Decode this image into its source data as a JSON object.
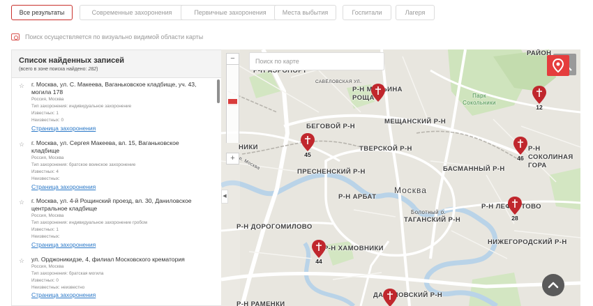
{
  "tabs": [
    {
      "label": "Все результаты",
      "active": true
    },
    {
      "label": "Современные захоронения",
      "active": false
    },
    {
      "label": "Первичные захоронения",
      "active": false
    },
    {
      "label": "Места выбытия",
      "active": false
    },
    {
      "label": "Госпитали",
      "active": false
    },
    {
      "label": "Лагеря",
      "active": false
    }
  ],
  "notice": "Поиск осуществляется по визуально видимой области карты",
  "panel": {
    "title": "Список найденных записей",
    "count_prefix": "(всего в зоне поиска найдено: ",
    "count_value": "282",
    "count_suffix": ")"
  },
  "records": [
    {
      "title": "г. Москва, ул. С. Макеева, Ваганьковское кладбище, уч. 43, могила 178",
      "country": "Россия, Москва",
      "type": "Тип захоронения: индивидуальное захоронение",
      "known": "Известных: 1",
      "unknown": "Неизвестных: 0",
      "link": "Страница захоронения"
    },
    {
      "title": "г. Москва, ул. Сергея Макеева, вл. 15, Ваганьковское кладбище",
      "country": "Россия, Москва",
      "type": "Тип захоронения: братское воинское захоронение",
      "known": "Известных: 4",
      "unknown": "Неизвестных:",
      "link": "Страница захоронения"
    },
    {
      "title": "г. Москва, ул. 4-й Рощинский проезд, вл. 30, Даниловское центральное кладбище",
      "country": "Россия, Москва",
      "type": "Тип захоронения: индивидуальное захоронение гробом",
      "known": "Известных: 1",
      "unknown": "Неизвестных:",
      "link": "Страница захоронения"
    },
    {
      "title": "ул. Орджоникидзе, 4, филиал Московского крематория",
      "country": "Россия, Москва",
      "type": "Тип захоронения: братская могила",
      "known": "Известных: 0",
      "unknown": "Неизвестных: неизвестно",
      "link": "Страница захоронения"
    }
  ],
  "search_placeholder": "Поиск по карте",
  "map_labels": {
    "aeroport": "Р-Н АЭРОПОРТ",
    "rayon_top": "РАЙОН",
    "savelovskaya": "САВЁЛОВСКАЯ УЛ.",
    "maryina_roshcha": "Р-Н МАРЬИНА РОЩА",
    "park": "Парк Сокольники",
    "begovoy": "БЕГОВОЙ Р-Н",
    "meshchansky": "МЕЩАНСКИЙ Р-Н",
    "tverskoy": "ТВЕРСКОЙ Р-Н",
    "sokolina_gora": "Р-Н СОКОЛИНАЯ ГОРА",
    "niki": "НИКИ",
    "basmanny": "БАСМАННЫЙ Р-Н",
    "presnensky": "ПРЕСНЕНСКИЙ Р-Н",
    "moskva": "Москва",
    "arbat": "Р-Н АРБАТ",
    "lefortovo": "Р-Н ЛЕФОРТОВО",
    "bolotny": "Болотный о.",
    "tagansky": "ТАГАНСКИЙ Р-Н",
    "dorogomilovo": "Р-Н ДОРОГОМИЛОВО",
    "khamovniki": "Р-Н ХАМОВНИКИ",
    "nizhegorodsky": "НИЖЕГОРОДСКИЙ Р-Н",
    "danilovsky": "ДАНИЛОВСКИЙ Р-Н",
    "ramenki": "Р-Н РАМЕНКИ",
    "moskva_river": "р. Москва"
  },
  "pins": [
    {
      "count": "12"
    },
    {
      "count": "45"
    },
    {
      "count": "46"
    },
    {
      "count": "28"
    },
    {
      "count": "44"
    },
    {
      "count": ""
    },
    {
      "count": ""
    }
  ],
  "colors": {
    "accent": "#e53d3d",
    "link": "#2a78c8",
    "pin": "#c0272d",
    "park": "#cfe4bd",
    "water": "#b9d3e8"
  }
}
